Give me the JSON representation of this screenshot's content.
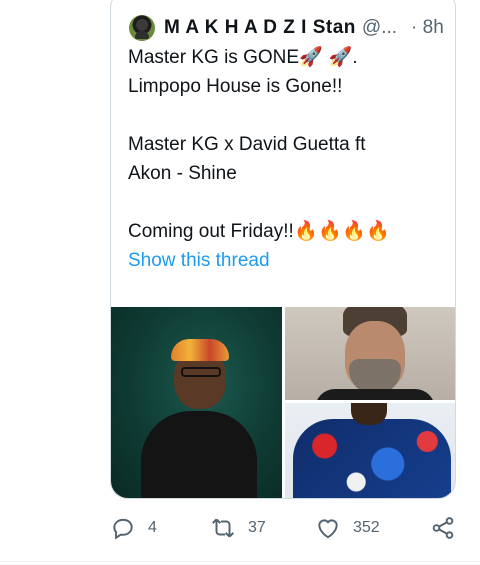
{
  "tweet": {
    "author_name": "M A K H A D Z I Stan",
    "handle": "@...",
    "time": "· 8h",
    "lines": [
      "Master KG is GONE",
      "Limpopo House is Gone!!",
      "Master KG x David Guetta ft",
      "Akon - Shine",
      "Coming out Friday!!"
    ],
    "line1_suffix": ".",
    "emoji": {
      "rocket": "🚀",
      "fire": "🔥"
    },
    "show_thread": "Show this thread",
    "media": [
      {
        "label": "photo-man-orange-hat"
      },
      {
        "label": "photo-david-guetta"
      },
      {
        "label": "photo-man-patterned-jacket"
      }
    ]
  },
  "actions": {
    "reply_count": "4",
    "retweet_count": "37",
    "like_count": "352"
  },
  "colors": {
    "link": "#1d9bf0",
    "muted": "#536471",
    "border": "#cfd9de"
  }
}
